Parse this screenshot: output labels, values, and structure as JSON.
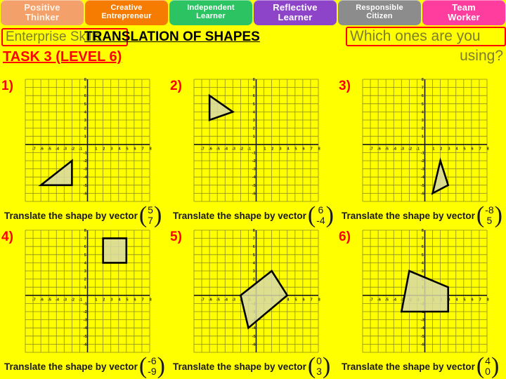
{
  "skill_bar": {
    "tabs": [
      {
        "line1": "Positive",
        "line2": "Thinker",
        "color": "#F4A06A",
        "text_color": "#FFF4E8"
      },
      {
        "line1": "Creative",
        "line2": "Entrepreneur",
        "color": "#F57C00",
        "text_color": "#FFFFFF"
      },
      {
        "line1": "Independent",
        "line2": "Learner",
        "color": "#2CC463",
        "text_color": "#FFFFFF"
      },
      {
        "line1": "Reflective",
        "line2": "Learner",
        "color": "#8E44C9",
        "text_color": "#FFFFFF"
      },
      {
        "line1": "Responsible",
        "line2": "Citizen",
        "color": "#8C8C8C",
        "text_color": "#FFFFFF"
      },
      {
        "line1": "Team",
        "line2": "Worker",
        "color": "#FF3D9E",
        "text_color": "#FFFFFF"
      }
    ]
  },
  "title_band": {
    "enterprise_skills": "Enterprise Skills",
    "main_heading": "TRANSLATION OF SHAPES",
    "which_ones_line1": "Which ones are you",
    "which_ones_line2": "using?",
    "task_label": "TASK 3 (LEVEL 6)",
    "accent_red": "#FF0000",
    "olive_text": "#7E7E2A",
    "page_background": "#FFFF00"
  },
  "caption_prefix": "Translate the shape by vector",
  "graph_common": {
    "x_ticks": [
      "-7",
      "-6",
      "-5",
      "-4",
      "-3",
      "-2",
      "-1",
      "1",
      "2",
      "3",
      "4",
      "5",
      "6",
      "7",
      "8"
    ],
    "y_ticks_positive": [
      "8",
      "7",
      "6",
      "5",
      "4",
      "3",
      "2",
      "1"
    ],
    "y_ticks_negative": [
      "-1",
      "-2",
      "-3",
      "-4",
      "-5",
      "-6"
    ],
    "x_min": -8,
    "x_max": 8,
    "y_min": -7,
    "y_max": 8,
    "grid_color": "#8B8B20",
    "axis_color": "#1a1a1a",
    "shape_fill": "#D8D8A8",
    "shape_stroke": "#000000"
  },
  "questions": [
    {
      "number": "1)",
      "vector_top": "5",
      "vector_bottom": "7",
      "shape_type": "triangle",
      "points": [
        [
          -6,
          -5
        ],
        [
          -2,
          -5
        ],
        [
          -2,
          -2
        ]
      ]
    },
    {
      "number": "2)",
      "vector_top": "6",
      "vector_bottom": "-4",
      "shape_type": "triangle",
      "points": [
        [
          -6,
          6
        ],
        [
          -6,
          3
        ],
        [
          -3,
          4
        ]
      ]
    },
    {
      "number": "3)",
      "vector_top": "-8",
      "vector_bottom": "5",
      "shape_type": "triangle",
      "points": [
        [
          2,
          -2
        ],
        [
          3,
          -5
        ],
        [
          1,
          -6
        ]
      ]
    },
    {
      "number": "4)",
      "vector_top": "-6",
      "vector_bottom": "-9",
      "shape_type": "rectangle",
      "points": [
        [
          2,
          7
        ],
        [
          5,
          7
        ],
        [
          5,
          4
        ],
        [
          2,
          4
        ]
      ]
    },
    {
      "number": "5)",
      "vector_top": "0",
      "vector_bottom": "3",
      "shape_type": "rotated-rectangle",
      "points": [
        [
          2,
          3
        ],
        [
          4,
          0
        ],
        [
          -1,
          -4
        ],
        [
          -2,
          0
        ]
      ]
    },
    {
      "number": "6)",
      "vector_top": "4",
      "vector_bottom": "0",
      "shape_type": "quadrilateral",
      "points": [
        [
          -2,
          3
        ],
        [
          3,
          1
        ],
        [
          3,
          -2
        ],
        [
          -3,
          -2
        ]
      ]
    }
  ]
}
